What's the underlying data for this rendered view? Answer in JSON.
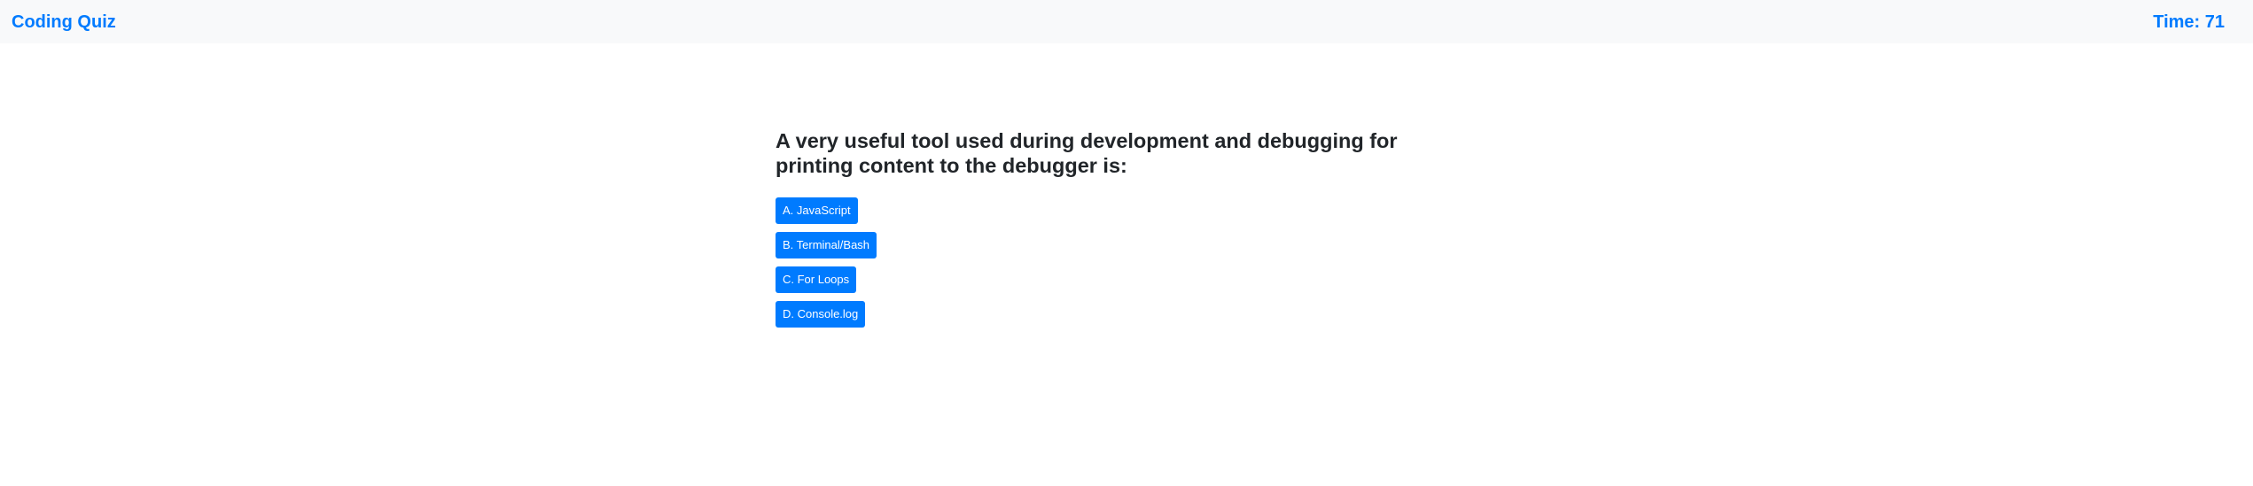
{
  "app": {
    "brand": "Coding Quiz",
    "timer": "Time: 71"
  },
  "question": {
    "text": "A very useful tool used during development and debugging for printing content to the debugger is:",
    "choices": [
      {
        "label": "A. JavaScript"
      },
      {
        "label": "B. Terminal/Bash"
      },
      {
        "label": "C. For Loops"
      },
      {
        "label": "D. Console.log"
      }
    ]
  },
  "colors": {
    "accent": "#007bff",
    "navbar_bg": "#f8f9fa",
    "text": "#212529"
  }
}
